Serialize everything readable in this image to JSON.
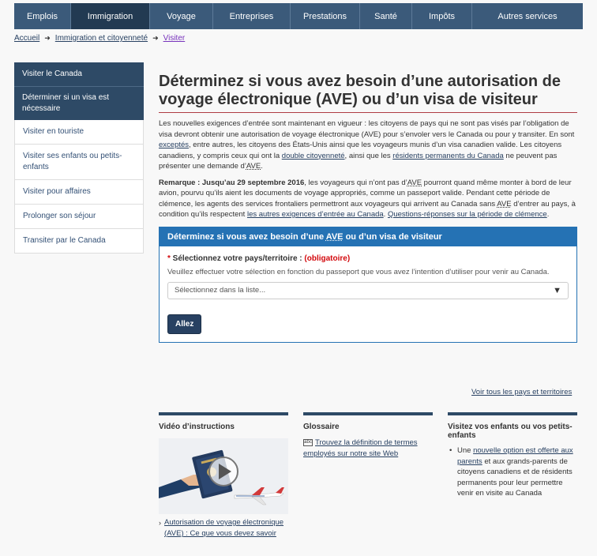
{
  "nav": {
    "items": [
      {
        "label": "Emplois"
      },
      {
        "label": "Immigration"
      },
      {
        "label": "Voyage"
      },
      {
        "label": "Entreprises"
      },
      {
        "label": "Prestations"
      },
      {
        "label": "Santé"
      },
      {
        "label": "Impôts"
      },
      {
        "label": "Autres services"
      }
    ]
  },
  "breadcrumb": {
    "home": "Accueil",
    "section": "Immigration et citoyenneté",
    "current": "Visiter"
  },
  "sidebar": {
    "title": "Visiter le Canada",
    "items": [
      {
        "label": "Déterminer si un visa est nécessaire"
      },
      {
        "label": "Visiter en touriste"
      },
      {
        "label": "Visiter ses enfants ou petits-enfants"
      },
      {
        "label": "Visiter pour affaires"
      },
      {
        "label": "Prolonger son séjour"
      },
      {
        "label": "Transiter par le Canada"
      }
    ]
  },
  "main": {
    "title": "Déterminez si vous avez besoin d’une autorisation de voyage électronique (AVE) ou d’un visa de visiteur",
    "p1_a": "Les nouvelles exigences d’entrée sont maintenant en vigueur : les citoyens de pays qui ne sont pas visés par l’obligation de visa devront obtenir une autorisation de voyage électronique (AVE) pour s’envoler vers le Canada ou pour y transiter. En sont ",
    "p1_link1": "exceptés",
    "p1_b": ", entre autres, les citoyens des États-Unis ainsi que les voyageurs munis d’un visa canadien valide. Les citoyens canadiens, y compris ceux qui ont la ",
    "p1_link2": "double citoyenneté",
    "p1_c": ", ainsi que les ",
    "p1_link3": "résidents permanents du Canada",
    "p1_d": " ne peuvent pas présenter une demande d’",
    "p1_abbr": "AVE",
    "p1_e": ".",
    "p2_bold": "Remarque : Jusqu’au 29 septembre 2016",
    "p2_a": ", les voyageurs qui n’ont pas d’",
    "p2_abbr1": "AVE",
    "p2_b": " pourront quand même monter à bord de leur avion, pourvu qu’ils aient les documents de voyage appropriés, comme un passeport valide. Pendant cette période de clémence, les agents des services frontaliers permettront aux voyageurs qui arrivent au Canada sans ",
    "p2_abbr2": "AVE",
    "p2_c": " d’entrer au pays, à condition qu’ils respectent ",
    "p2_link1": "les autres exigences d’entrée au Canada",
    "p2_d": ". ",
    "p2_link2": "Questions-réponses sur la période de clémence",
    "p2_e": "."
  },
  "form": {
    "heading_a": "Déterminez si vous avez besoin d’une ",
    "heading_abbr": "AVE",
    "heading_b": " ou d’un visa de visiteur",
    "label_star": "*",
    "label": " Sélectionnez votre pays/territoire : ",
    "required": "(obligatoire)",
    "help": "Veuillez effectuer votre sélection en fonction du passeport que vous avez l’intention d’utiliser pour venir au Canada.",
    "select_value": "Sélectionnez dans la liste...",
    "button": "Allez"
  },
  "see_all": "Voir tous les pays et territoires",
  "columns": {
    "video": {
      "title": "Vidéo d’instructions",
      "link": "Autorisation de voyage électronique (AVE) : Ce que vous devez savoir"
    },
    "glossary": {
      "title": "Glossaire",
      "icon_text": "abc",
      "link": "Trouvez la définition de termes employés sur notre site Web"
    },
    "family": {
      "title": "Visitez vos enfants ou vos petits-enfants",
      "text_a": "Une ",
      "link": "nouvelle option est offerte aux parents",
      "text_b": " et aux grands-parents de citoyens canadiens et de résidents permanents pour leur permettre venir en visite au Canada"
    }
  },
  "colors": {
    "nav_bg": "#3b5a7a",
    "nav_active": "#223a52",
    "panel_blue": "#2572b4",
    "accent_red": "#af3c43",
    "button_bg": "#284162"
  }
}
